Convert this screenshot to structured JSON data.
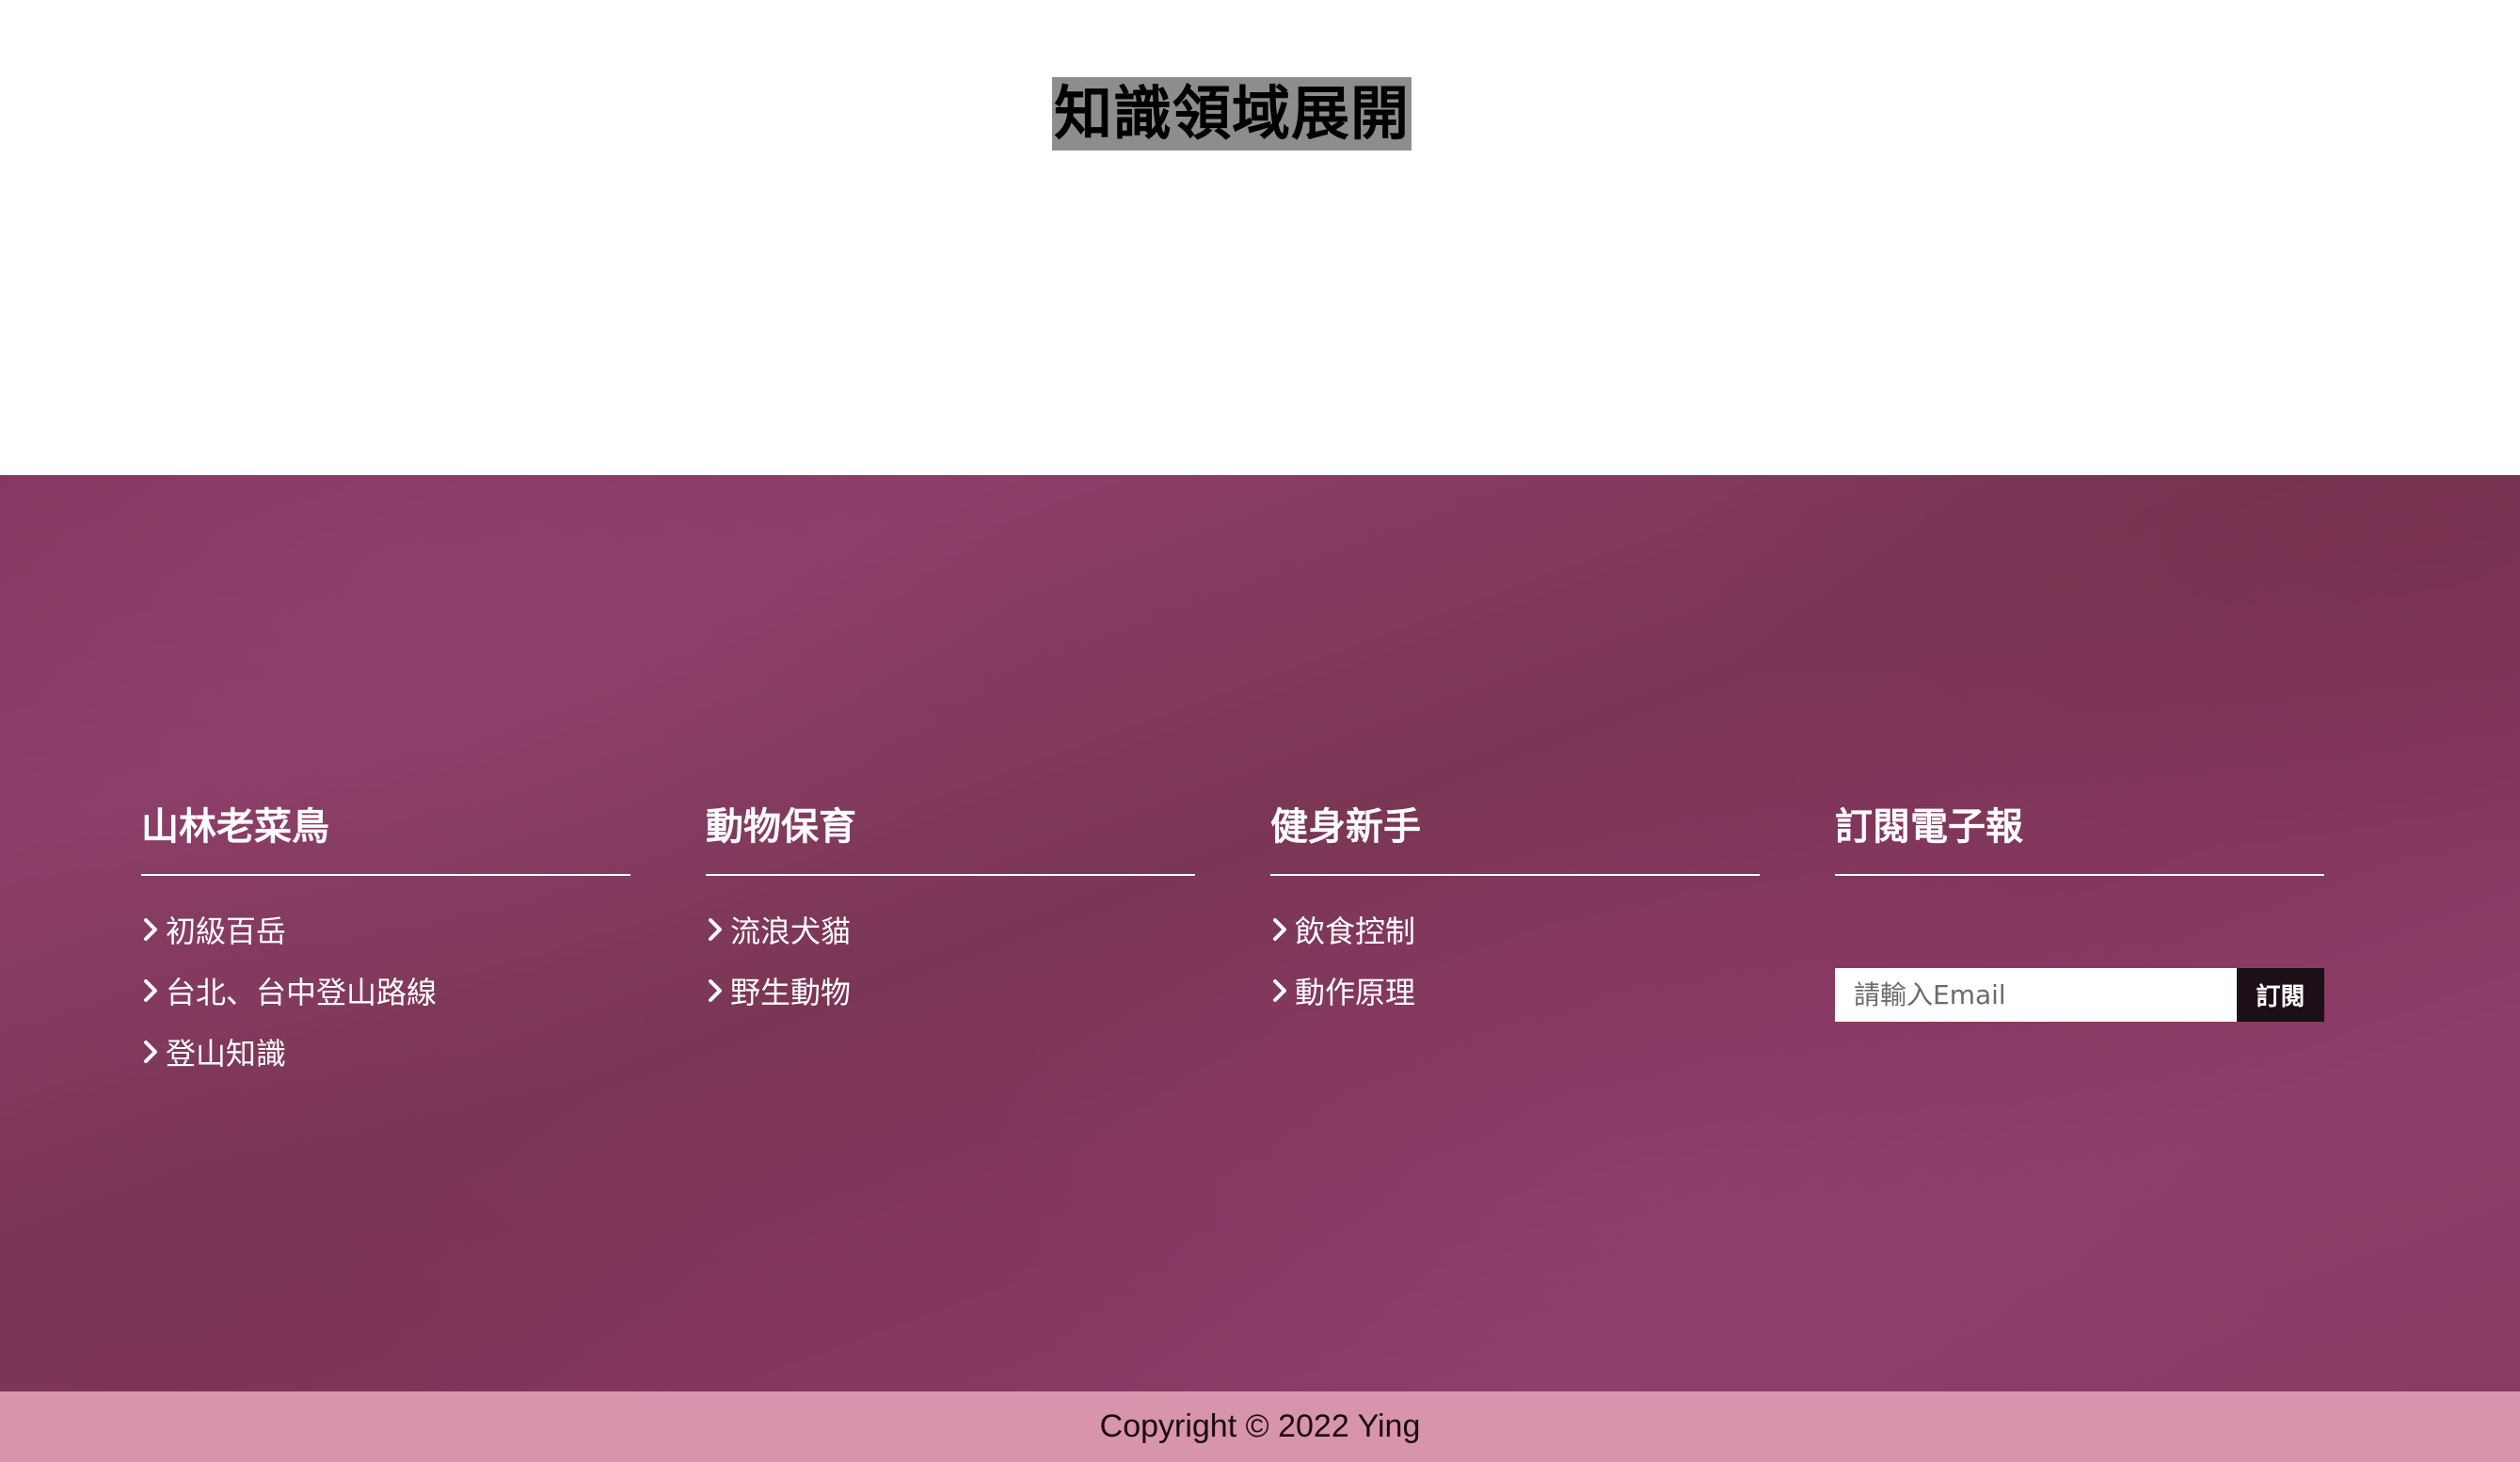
{
  "header": {
    "title": "知識領域展開"
  },
  "footer": {
    "columns": [
      {
        "heading": "山林老菜鳥",
        "links": [
          "初級百岳",
          "台北、台中登山路線",
          "登山知識"
        ]
      },
      {
        "heading": "動物保育",
        "links": [
          "流浪犬貓",
          "野生動物"
        ]
      },
      {
        "heading": "健身新手",
        "links": [
          "飲食控制",
          "動作原理"
        ]
      }
    ],
    "newsletter": {
      "heading": "訂閱電子報",
      "placeholder": "請輸入Email",
      "value": "",
      "button_label": "訂閱"
    },
    "copyright": "Copyright © 2022 Ying"
  },
  "colors": {
    "footer_bg": "#84375f",
    "copyright_bg": "#d894ad",
    "button_bg": "#1d0f18",
    "title_highlight": "#8d8d8d"
  },
  "icons": {
    "link_bullet": "chevron-right-icon"
  }
}
